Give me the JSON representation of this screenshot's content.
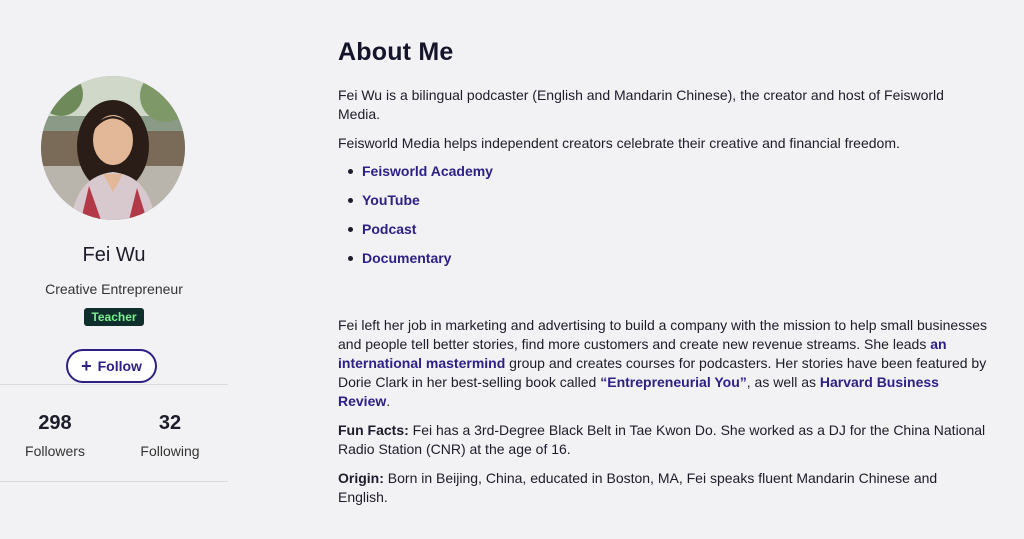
{
  "profile": {
    "name": "Fei Wu",
    "title": "Creative Entrepreneur",
    "badge": "Teacher",
    "follow_label": "Follow",
    "followers_count": "298",
    "followers_label": "Followers",
    "following_count": "32",
    "following_label": "Following"
  },
  "about": {
    "heading": "About Me",
    "intro": "Fei Wu is a bilingual podcaster (English and Mandarin Chinese), the creator and host of Feisworld Media.",
    "mission": "Feisworld Media helps independent creators celebrate their creative and financial freedom.",
    "links": [
      "Feisworld Academy",
      "YouTube",
      "Podcast",
      "Documentary"
    ],
    "bio": {
      "part1": "Fei left her job in marketing and advertising to build a company with the mission to help small businesses and people tell better stories, find more customers and create new revenue streams. She leads ",
      "link1": "an international mastermind",
      "part2": " group and creates courses for podcasters. Her stories have been featured by Dorie Clark in her best-selling book called ",
      "link2": "“Entrepreneurial You”",
      "part3": ", as well as ",
      "link3": "Harvard Business Review",
      "part4": "."
    },
    "fun_facts_label": "Fun Facts:",
    "fun_facts": " Fei has a 3rd-Degree Black Belt in Tae Kwon Do. She worked as a DJ for the China National Radio Station (CNR) at the age of 16.",
    "origin_label": "Origin:",
    "origin": " Born in Beijing, China,  educated in Boston, MA, Fei speaks fluent Mandarin Chinese and English."
  },
  "colors": {
    "background": "#f2f2f4",
    "link": "#2d2085",
    "badge_bg": "#0f2f2d",
    "badge_text": "#7cf08e"
  }
}
